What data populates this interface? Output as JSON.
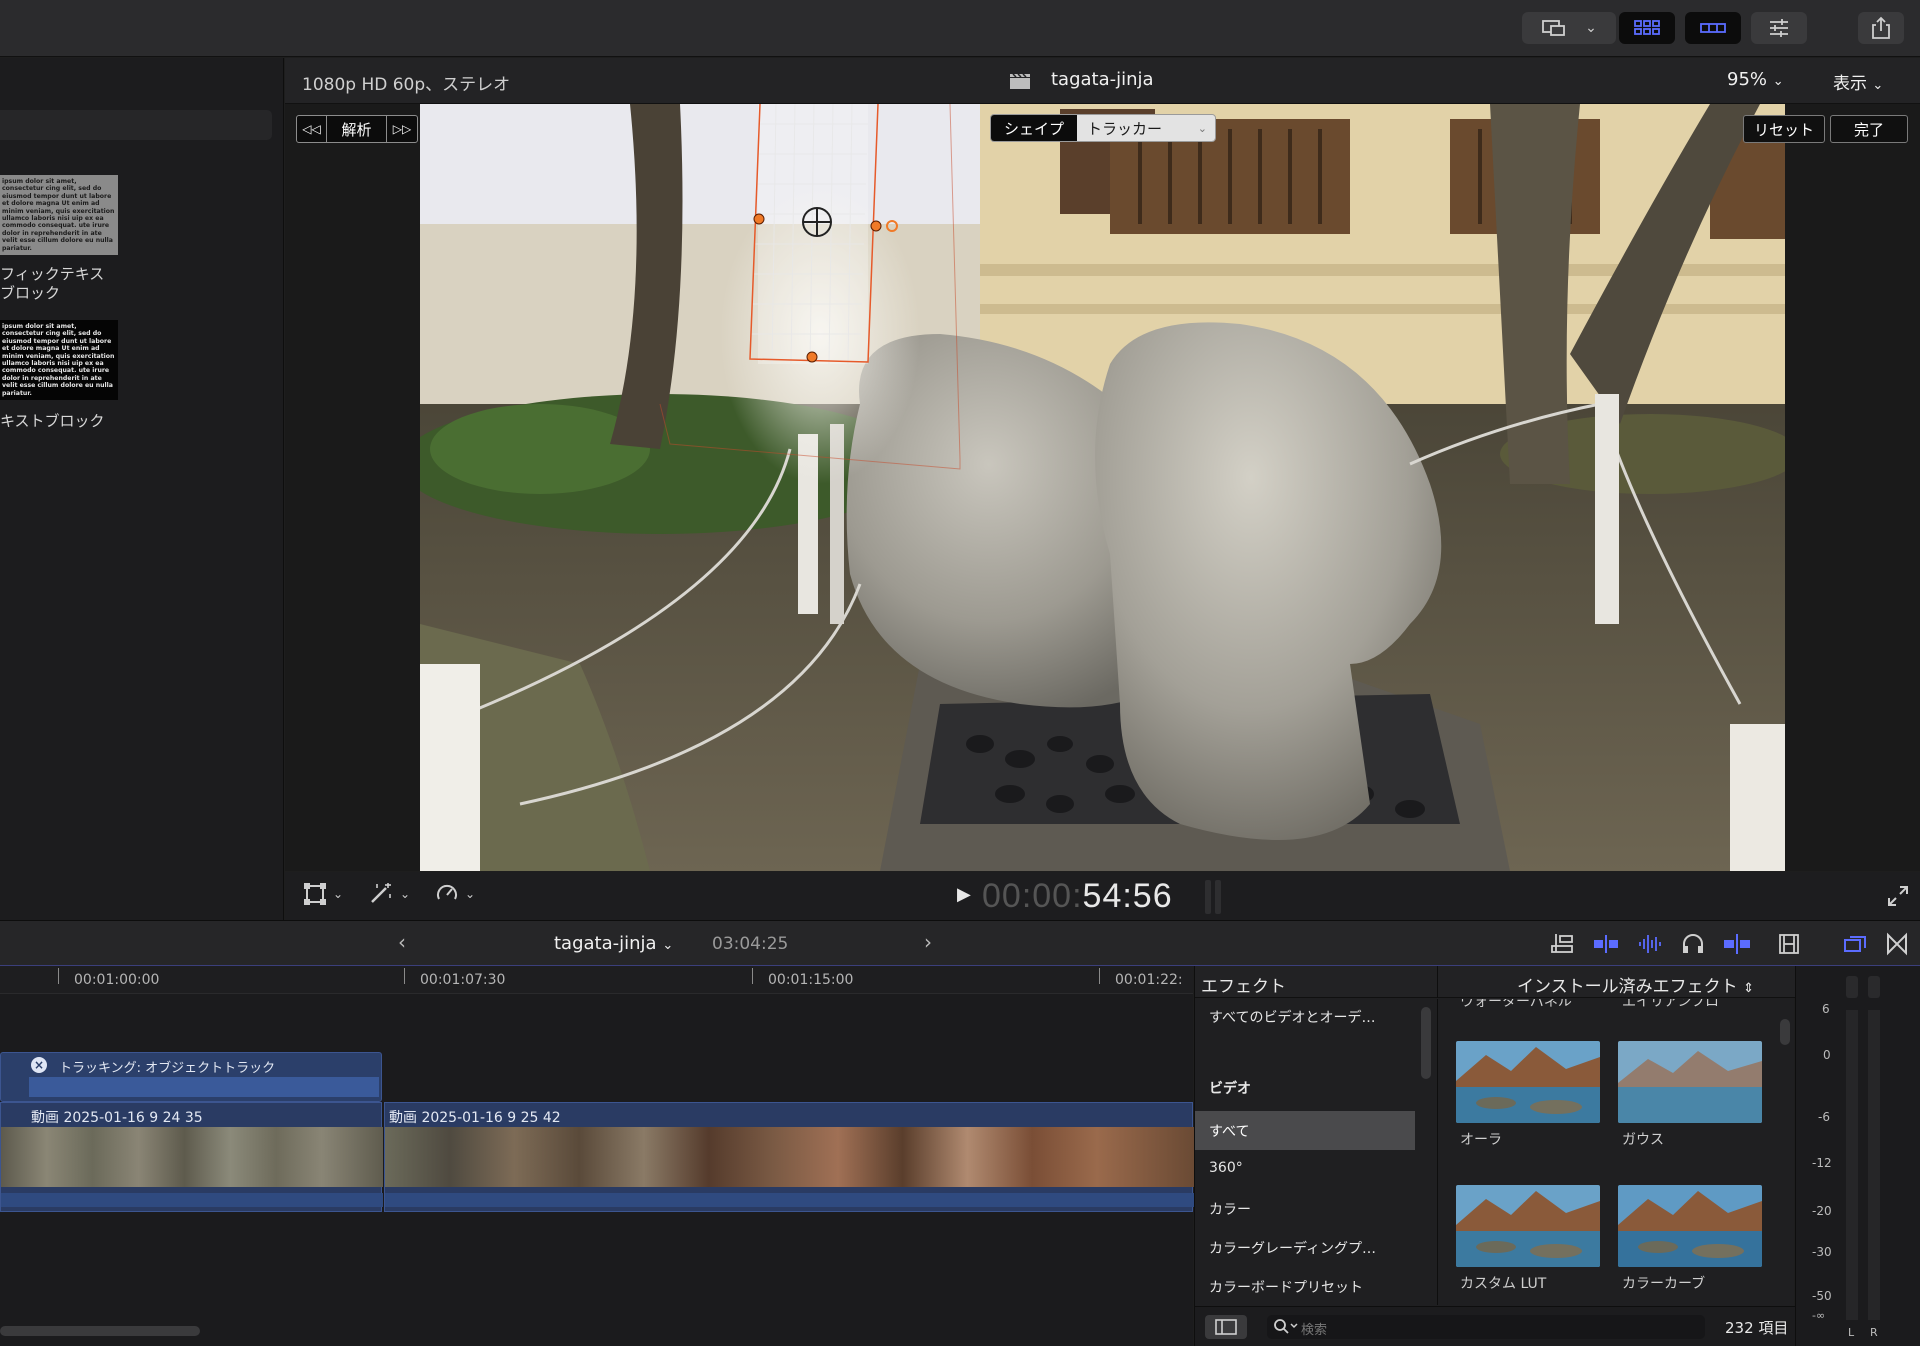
{
  "viewer": {
    "format": "1080p HD 60p、ステレオ",
    "project": "tagata-jinja",
    "zoom": "95%",
    "view_label": "表示",
    "analyze_label": "解析",
    "mode_shape": "シェイプ",
    "mode_tracker": "トラッカー",
    "reset_label": "リセット",
    "done_label": "完了",
    "timecode_dim": "00:00:",
    "timecode_bright": "54:56"
  },
  "browser": {
    "items": [
      {
        "label_line1": "フィックテキス",
        "label_line2": "ブロック",
        "preview_text": "ipsum dolor sit amet, consectetur cing elit, sed do eiusmod tempor dunt ut labore et dolore magna Ut enim ad minim veniam, quis exercitation ullamco laboris nisi uip ex ea commodo consequat. ute irure dolor in reprehenderit in ate velit esse cillum dolore eu nulla pariatur."
      },
      {
        "label_line1": "キストブロック",
        "label_line2": "",
        "preview_text": "ipsum dolor sit amet, consectetur cing elit, sed do eiusmod tempor dunt ut labore et dolore magna Ut enim ad minim veniam, quis exercitation ullamco laboris nisi uip ex ea commodo consequat. ute irure dolor in reprehenderit in ate velit esse cillum dolore eu nulla pariatur."
      }
    ]
  },
  "timeline": {
    "project": "tagata-jinja",
    "duration": "03:04:25",
    "ruler": [
      "00:01:00:00",
      "00:01:07:30",
      "00:01:15:00",
      "00:01:22:"
    ],
    "tracking_label": "トラッキング: オブジェクトトラック",
    "clip1": "動画 2025-01-16 9 24 35",
    "clip2": "動画 2025-01-16 9 25 42"
  },
  "effects": {
    "header_left": "エフェクト",
    "header_right": "インストール済みエフェクト",
    "categories": [
      "すべてのビデオとオーデ…",
      "ビデオ",
      "すべて",
      "360°",
      "カラー",
      "カラーグレーディングプ…",
      "カラーボードプリセット"
    ],
    "selected_category": "すべて",
    "partial_top": [
      "ウォーターパネル",
      "エイリアンフロ"
    ],
    "items": [
      "オーラ",
      "ガウス",
      "カスタム LUT",
      "カラーカーブ"
    ],
    "search_placeholder": "検索",
    "count": "232 項目"
  },
  "meter": {
    "scale": [
      "6",
      "0",
      "-6",
      "-12",
      "-20",
      "-30",
      "-50",
      "-∞"
    ],
    "channels": [
      "L",
      "R"
    ]
  }
}
